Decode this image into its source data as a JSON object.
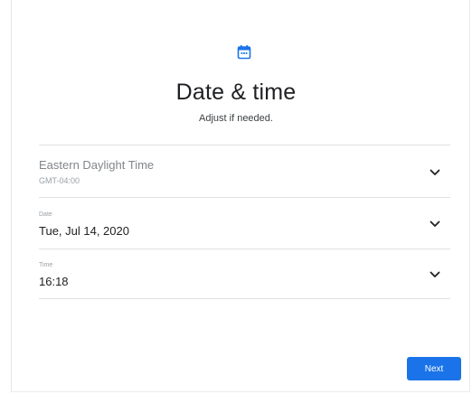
{
  "header": {
    "icon": "calendar-icon",
    "title": "Date & time",
    "subtitle": "Adjust if needed."
  },
  "timezone": {
    "name": "Eastern Daylight Time",
    "offset": "GMT-04:00",
    "icon": "chevron-down-icon"
  },
  "date": {
    "label": "Date",
    "value": "Tue, Jul 14, 2020",
    "icon": "chevron-down-icon"
  },
  "time": {
    "label": "Time",
    "value": "16:18",
    "icon": "chevron-down-icon"
  },
  "footer": {
    "next_label": "Next"
  },
  "colors": {
    "accent": "#1a73e8",
    "title_text": "#202124",
    "muted_text": "#80868b",
    "divider": "#e0e0e0"
  }
}
